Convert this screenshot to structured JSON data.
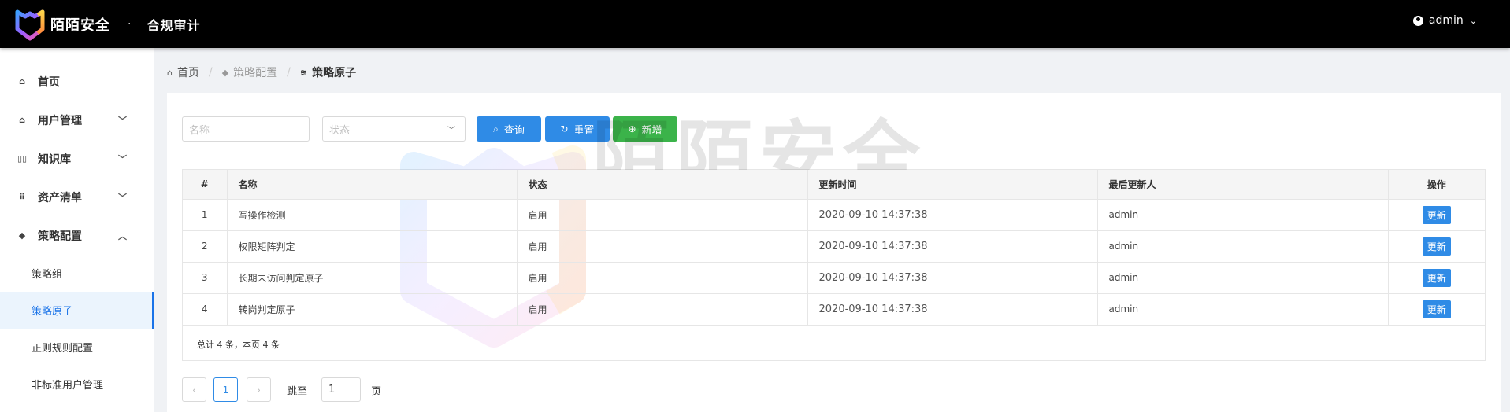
{
  "header": {
    "brand": "陌陌安全",
    "separator": "·",
    "app_title": "合规审计",
    "user": "admin"
  },
  "sidebar": {
    "items": [
      {
        "label": "首页",
        "icon": "home-icon"
      },
      {
        "label": "用户管理",
        "icon": "home-icon",
        "arrow": "down"
      },
      {
        "label": "知识库",
        "icon": "book-icon",
        "arrow": "down"
      },
      {
        "label": "资产清单",
        "icon": "grid-icon",
        "arrow": "down"
      },
      {
        "label": "策略配置",
        "icon": "cube-icon",
        "arrow": "up"
      }
    ],
    "sub_items": [
      {
        "label": "策略组"
      },
      {
        "label": "策略原子"
      },
      {
        "label": "正则规则配置"
      },
      {
        "label": "非标准用户管理"
      }
    ]
  },
  "breadcrumb": [
    {
      "label": "首页",
      "icon": "home-icon"
    },
    {
      "label": "策略配置",
      "icon": "cube-icon"
    },
    {
      "label": "策略原子",
      "icon": "layers-icon"
    }
  ],
  "filters": {
    "name_placeholder": "名称",
    "status_placeholder": "状态",
    "query_label": "查询",
    "reset_label": "重置",
    "add_label": "新增"
  },
  "table": {
    "columns": [
      "#",
      "名称",
      "状态",
      "更新时间",
      "最后更新人",
      "操作"
    ],
    "rows": [
      {
        "no": "1",
        "name": "写操作检测",
        "status": "启用",
        "time": "2020-09-10 14:37:38",
        "user": "admin",
        "action": "更新"
      },
      {
        "no": "2",
        "name": "权限矩阵判定",
        "status": "启用",
        "time": "2020-09-10 14:37:38",
        "user": "admin",
        "action": "更新"
      },
      {
        "no": "3",
        "name": "长期未访问判定原子",
        "status": "启用",
        "time": "2020-09-10 14:37:38",
        "user": "admin",
        "action": "更新"
      },
      {
        "no": "4",
        "name": "转岗判定原子",
        "status": "启用",
        "time": "2020-09-10 14:37:38",
        "user": "admin",
        "action": "更新"
      }
    ],
    "summary": "总计 4 条，本页 4 条"
  },
  "pagination": {
    "prev": "‹",
    "page": "1",
    "next": "›",
    "jump_label": "跳至",
    "jump_value": "1",
    "page_suffix": "页"
  },
  "watermark": {
    "text": "陌陌安全"
  },
  "colors": {
    "primary": "#2f8be6",
    "success": "#3bb34a",
    "header_bg": "#000000",
    "active_bg": "#ebf4fd"
  }
}
